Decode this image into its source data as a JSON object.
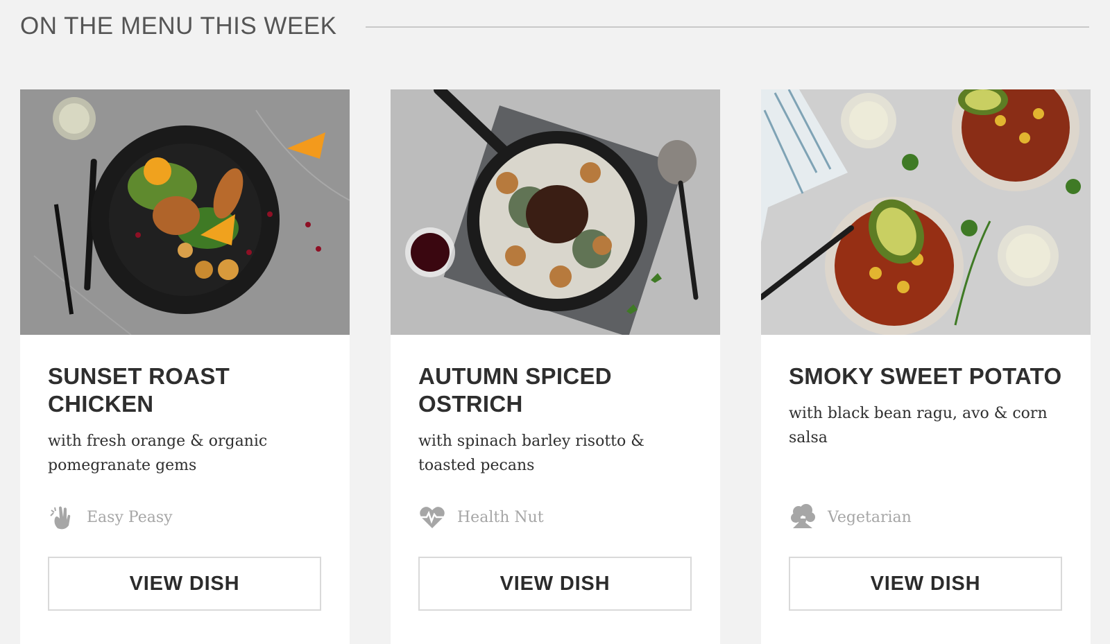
{
  "section": {
    "title": "ON THE MENU THIS WEEK"
  },
  "dishes": [
    {
      "title": "SUNSET ROAST CHICKEN",
      "subtitle": "with fresh orange & organic pomegranate gems",
      "tag": "Easy Peasy",
      "tag_icon": "hand-ok-icon",
      "button": "VIEW DISH"
    },
    {
      "title": "AUTUMN SPICED OSTRICH",
      "subtitle": "with spinach barley risotto & toasted pecans",
      "tag": "Health Nut",
      "tag_icon": "heartbeat-icon",
      "button": "VIEW DISH"
    },
    {
      "title": "SMOKY SWEET POTATO",
      "subtitle": "with black bean ragu, avo & corn salsa",
      "tag": "Vegetarian",
      "tag_icon": "broccoli-icon",
      "button": "VIEW DISH"
    }
  ],
  "colors": {
    "page_background": "#f2f2f2",
    "card_background": "#ffffff",
    "tag_text": "#a6a6a6",
    "button_border": "#d9d9d9"
  }
}
